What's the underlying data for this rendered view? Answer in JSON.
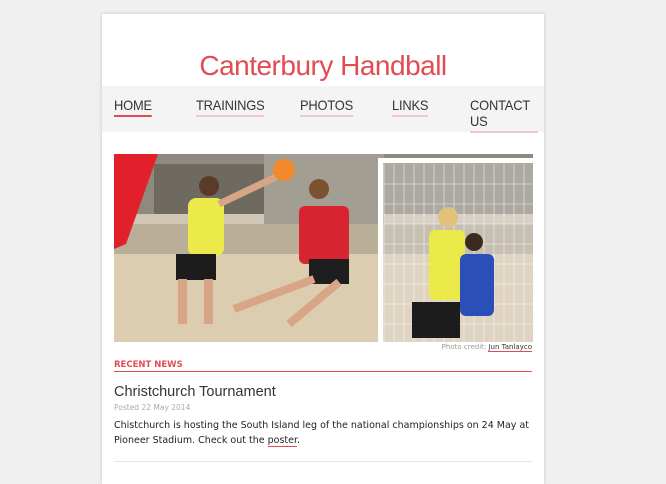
{
  "site": {
    "title": "Canterbury Handball"
  },
  "nav": {
    "items": [
      {
        "label": "HOME",
        "active": true
      },
      {
        "label": "TRAININGS",
        "active": false
      },
      {
        "label": "PHOTOS",
        "active": false
      },
      {
        "label": "LINKS",
        "active": false
      },
      {
        "label": "CONTACT US",
        "active": false
      }
    ]
  },
  "hero": {
    "credit_prefix": "Photo credit:",
    "credit_name": "Jun Tanlayco"
  },
  "news": {
    "section_label": "RECENT NEWS",
    "posts": [
      {
        "title": "Christchurch Tournament",
        "date": "Posted 22 May 2014",
        "body_before_link": "Chistchurch is hosting the South Island leg of the national championships on 24 May at Pioneer Stadium. Check out the ",
        "link_text": "poster",
        "body_after_link": "."
      }
    ]
  },
  "colors": {
    "accent": "#e34b52",
    "background": "#f0f0f0",
    "nav_background": "#f4f4f4"
  }
}
